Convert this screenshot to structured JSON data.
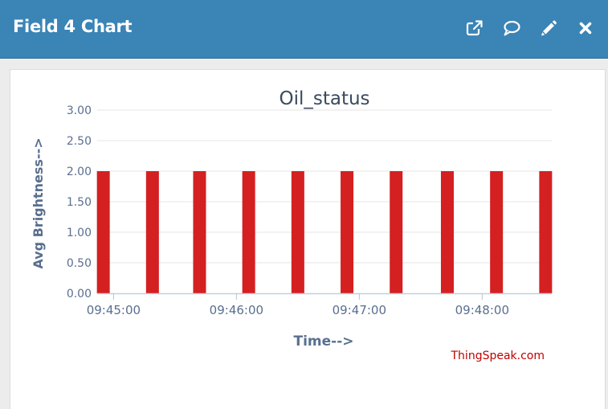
{
  "header": {
    "title": "Field 4 Chart",
    "icons": [
      "external-link-icon",
      "comment-icon",
      "pencil-icon",
      "close-icon"
    ]
  },
  "colors": {
    "header_bg": "#3a84b6",
    "bar": "#d42020",
    "axis_text": "#5a6f8f",
    "credit": "#c00000"
  },
  "credit": "ThingSpeak.com",
  "chart_data": {
    "type": "bar",
    "title": "Oil_status",
    "xlabel": "Time-->",
    "ylabel": "Avg Brightness-->",
    "ylim": [
      0,
      3
    ],
    "yticks": [
      "0.00",
      "0.50",
      "1.00",
      "1.50",
      "2.00",
      "2.50",
      "3.00"
    ],
    "xlim": [
      "09:44:52",
      "09:48:34"
    ],
    "xticks": [
      "09:45:00",
      "09:46:00",
      "09:47:00",
      "09:48:00"
    ],
    "grid": true,
    "legend": "none",
    "points": [
      {
        "x": "09:44:55",
        "y": 2
      },
      {
        "x": "09:45:19",
        "y": 2
      },
      {
        "x": "09:45:42",
        "y": 2
      },
      {
        "x": "09:46:06",
        "y": 2
      },
      {
        "x": "09:46:30",
        "y": 2
      },
      {
        "x": "09:46:54",
        "y": 2
      },
      {
        "x": "09:47:18",
        "y": 2
      },
      {
        "x": "09:47:43",
        "y": 2
      },
      {
        "x": "09:48:07",
        "y": 2
      },
      {
        "x": "09:48:31",
        "y": 2
      }
    ]
  }
}
